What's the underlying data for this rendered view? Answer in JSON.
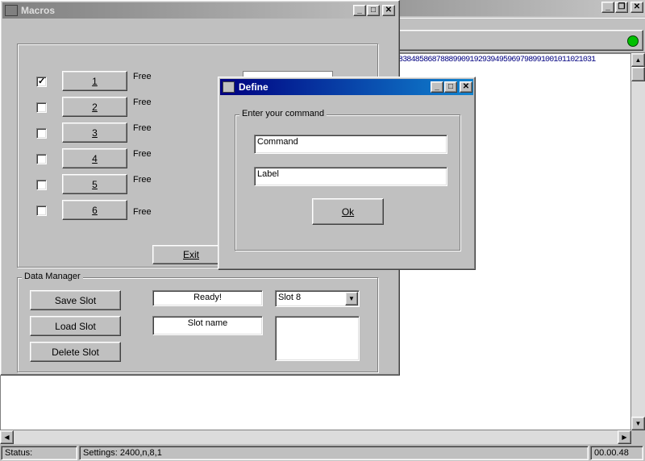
{
  "terminal": {
    "data_line": "83848586878889909192939495969798991001011021031",
    "status_label": "Status:",
    "settings_label": "Settings: 2400,n,8,1",
    "timer": "00.00.48",
    "indicator_color": "#00c000"
  },
  "macros": {
    "title": "Macros",
    "slots": [
      {
        "label": "1",
        "state": "Free",
        "checked": true
      },
      {
        "label": "2",
        "state": "Free",
        "checked": false
      },
      {
        "label": "3",
        "state": "Free",
        "checked": false
      },
      {
        "label": "4",
        "state": "Free",
        "checked": false
      },
      {
        "label": "5",
        "state": "Free",
        "checked": false
      },
      {
        "label": "6",
        "state": "Free",
        "checked": false
      }
    ],
    "exit_label": "Exit",
    "data_manager": {
      "legend": "Data Manager",
      "save_label": "Save Slot",
      "load_label": "Load Slot",
      "delete_label": "Delete Slot",
      "status_value": "Ready!",
      "slot_name_value": "Slot name",
      "selected_slot": "Slot 8"
    }
  },
  "define": {
    "title": "Define",
    "legend": "Enter your command",
    "command_value": "Command",
    "label_value": "Label",
    "ok_label": "Ok"
  }
}
